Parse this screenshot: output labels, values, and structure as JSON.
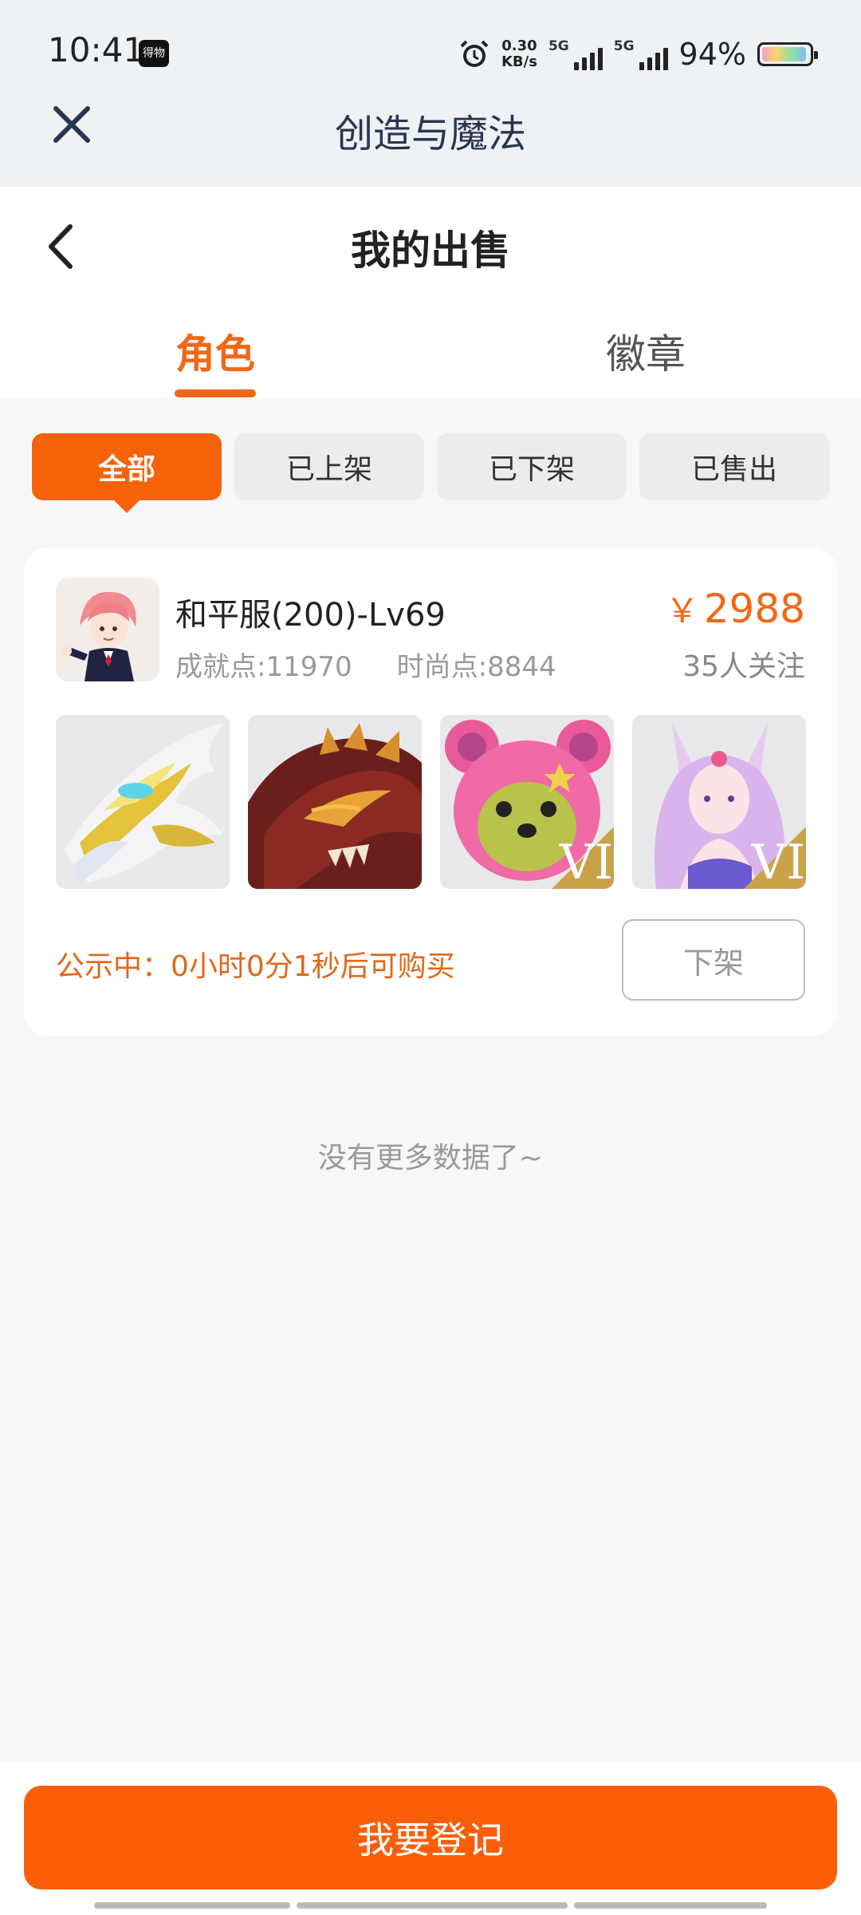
{
  "status_bar": {
    "time": "10:41",
    "app_badge": "得物",
    "net_speed_value": "0.30",
    "net_speed_unit": "KB/s",
    "network_1": "5G",
    "network_2": "5G",
    "battery_percent": "94%",
    "battery_level": 0.94
  },
  "mini_app": {
    "title": "创造与魔法",
    "close_icon": "close-icon"
  },
  "page": {
    "title": "我的出售",
    "back_icon": "chevron-left-icon"
  },
  "tabs": [
    {
      "label": "角色",
      "active": true
    },
    {
      "label": "徽章",
      "active": false
    }
  ],
  "filters": [
    {
      "label": "全部",
      "active": true
    },
    {
      "label": "已上架",
      "active": false
    },
    {
      "label": "已下架",
      "active": false
    },
    {
      "label": "已售出",
      "active": false
    }
  ],
  "listing": {
    "name": "和平服(200)-Lv69",
    "achievement": "成就点:11970",
    "fashion": "时尚点:8844",
    "price_symbol": "￥",
    "price": "2988",
    "followers": "35人关注",
    "thumbnails": [
      {
        "icon": "white-gold-dragon-icon",
        "badge": ""
      },
      {
        "icon": "red-dragon-icon",
        "badge": ""
      },
      {
        "icon": "pink-bear-icon",
        "badge": "VI"
      },
      {
        "icon": "fox-spirit-girl-icon",
        "badge": "VI"
      }
    ],
    "notice": "公示中：0小时0分1秒后可购买",
    "delist_label": "下架"
  },
  "footer_note": "没有更多数据了~",
  "bottom": {
    "register_label": "我要登记"
  },
  "colors": {
    "accent": "#f26716",
    "button": "#fb5e08"
  }
}
